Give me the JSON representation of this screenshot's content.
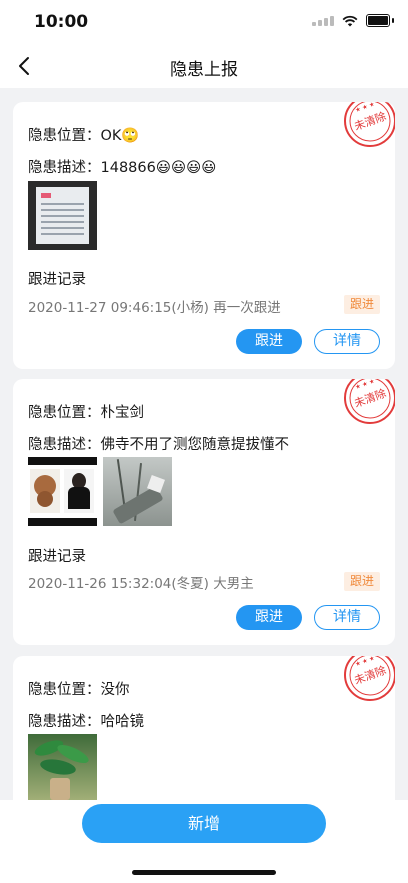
{
  "status_bar": {
    "time": "10:00"
  },
  "nav": {
    "title": "隐患上报"
  },
  "labels": {
    "location_prefix": "隐患位置：",
    "desc_prefix": "隐患描述：",
    "record_label": "跟进记录",
    "follow_tag": "跟进",
    "follow_button": "跟进",
    "detail_button": "详情",
    "stamp_text": "未清除"
  },
  "cards": [
    {
      "location": "OK🙄",
      "description": "148866😃😃😃😃",
      "record": "2020-11-27 09:46:15(小杨) 再一次跟进"
    },
    {
      "location": "朴宝剑",
      "description": "佛寺不用了测您随意提拔懂不",
      "record": "2020-11-26 15:32:04(冬夏) 大男主"
    },
    {
      "location": "没你",
      "description": "哈哈镜"
    }
  ],
  "bottom": {
    "add_label": "新增"
  },
  "colors": {
    "accent": "#2496f2",
    "stamp": "#e23b3b",
    "tag_bg": "#fdeee2",
    "tag_text": "#f08a3c"
  }
}
